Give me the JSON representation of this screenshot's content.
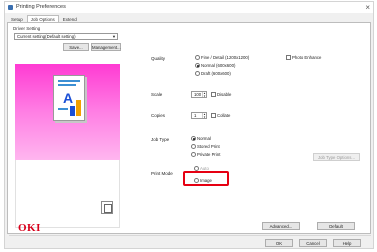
{
  "window": {
    "title": "Printing Preferences",
    "close_label": "×"
  },
  "tabs": [
    "Setup",
    "Job Options",
    "Extend"
  ],
  "driver_setting": {
    "label": "Driver Setting",
    "selected": "Current setting(Default setting)",
    "save_label": "Save...",
    "management_label": "Management..."
  },
  "quality": {
    "label": "Quality",
    "options": [
      "Fine / Detail (1200x1200)",
      "Normal (600x600)",
      "Draft (600x600)"
    ],
    "selected_index": 1,
    "photo_enhance_label": "Photo Enhance"
  },
  "scale": {
    "label": "Scale",
    "value": "100",
    "disable_label": "Disable"
  },
  "copies": {
    "label": "Copies",
    "value": "1",
    "collate_label": "Collate"
  },
  "job_type": {
    "label": "Job Type",
    "options": [
      "Normal",
      "Stored Print",
      "Private Print"
    ],
    "selected_index": 0,
    "options_button_label": "Job Type Options..."
  },
  "print_mode": {
    "label": "Print Mode",
    "options": [
      "Auto",
      "Image"
    ]
  },
  "footer": {
    "logo": "OKI",
    "advanced_label": "Advanced...",
    "default_label": "Default",
    "ok_label": "OK",
    "cancel_label": "Cancel",
    "help_label": "Help"
  },
  "colors": {
    "accent_red": "#e60012",
    "logo_red": "#d9001b",
    "preview_pink": "#ff3bd3"
  }
}
